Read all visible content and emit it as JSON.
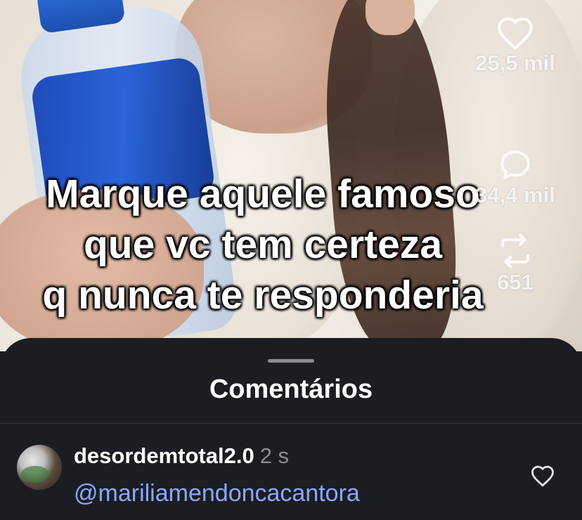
{
  "video": {
    "caption_lines": [
      "Marque aquele famoso",
      "que vc tem certeza",
      "q nunca te responderia"
    ]
  },
  "actions": {
    "likes": {
      "icon": "heart-icon",
      "count": "25,5 mil"
    },
    "comments": {
      "icon": "comment-bubble-icon",
      "count": "34,4 mil"
    },
    "reposts": {
      "icon": "repost-icon",
      "count": "651"
    }
  },
  "sheet": {
    "title": "Comentários"
  },
  "comments": [
    {
      "username": "desordemtotal2.0",
      "time": "2 s",
      "text": "@mariliamendoncacantora",
      "like_icon": "heart-outline-icon"
    }
  ],
  "colors": {
    "sheet_bg": "#1c1d22",
    "mention": "#8aa8ff",
    "muted": "#8e8f94"
  }
}
